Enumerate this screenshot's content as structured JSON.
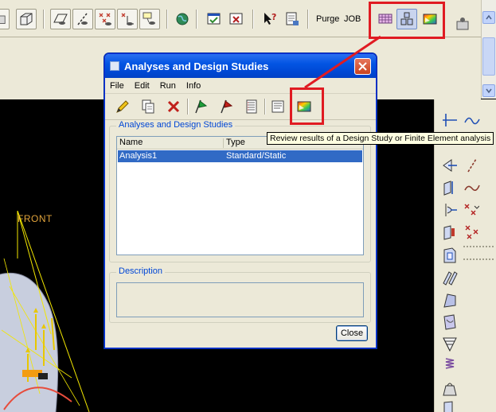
{
  "toolbar": {
    "purge_label": "Purge",
    "job_label": "JOB"
  },
  "dialog": {
    "title": "Analyses and Design Studies",
    "menu": [
      "File",
      "Edit",
      "Run",
      "Info"
    ],
    "group_label": "Analyses and Design Studies",
    "columns": [
      "Name",
      "Type"
    ],
    "rows": [
      {
        "name": "Analysis1",
        "type": "Standard/Static",
        "selected": true
      }
    ],
    "description_label": "Description",
    "description_value": "",
    "close_label": "Close"
  },
  "tooltip": {
    "text": "Review results of a Design Study or Finite Element analysis"
  },
  "viewport": {
    "view_label": "FRONT"
  },
  "colors": {
    "annotation_red": "#e01b22",
    "selection_blue": "#316ac5",
    "title_blue": "#0355e3",
    "view_label_orange": "#e1a33b"
  }
}
